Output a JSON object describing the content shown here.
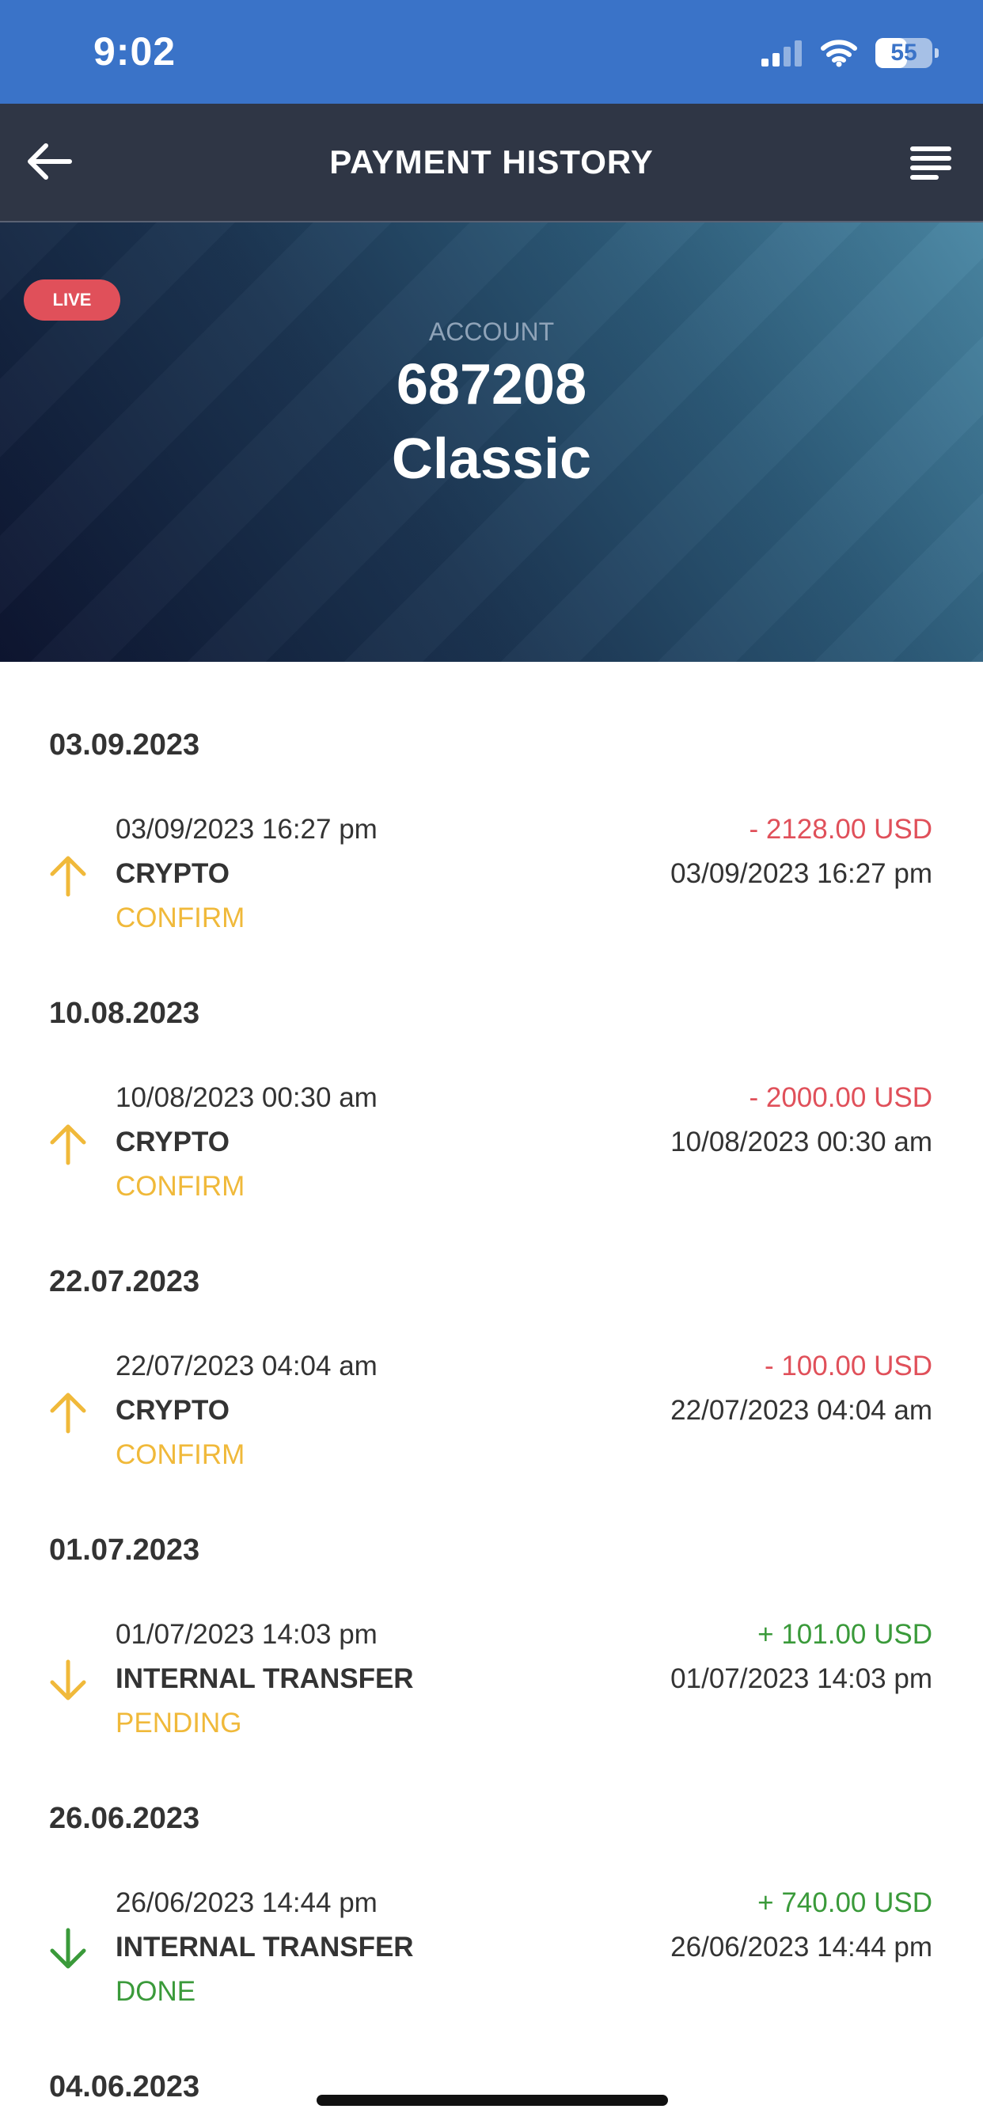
{
  "status_bar": {
    "time": "9:02",
    "battery": "55",
    "battery_level": 0.55
  },
  "nav": {
    "title": "PAYMENT HISTORY"
  },
  "account": {
    "badge": "LIVE",
    "label": "ACCOUNT",
    "number": "687208",
    "type": "Classic"
  },
  "colors": {
    "negative": "#e0505a",
    "positive": "#3a9a3a",
    "pending": "#f0b93a",
    "done": "#3a9a3a",
    "up_arrow": "#f0b93a"
  },
  "groups": [
    {
      "date": "03.09.2023",
      "tx": {
        "time": "03/09/2023 16:27 pm",
        "amount": "- 2128.00 USD",
        "method": "CRYPTO",
        "time_right": "03/09/2023 16:27 pm",
        "status": "CONFIRM",
        "direction": "up"
      }
    },
    {
      "date": "10.08.2023",
      "tx": {
        "time": "10/08/2023 00:30 am",
        "amount": "- 2000.00 USD",
        "method": "CRYPTO",
        "time_right": "10/08/2023 00:30 am",
        "status": "CONFIRM",
        "direction": "up"
      }
    },
    {
      "date": "22.07.2023",
      "tx": {
        "time": "22/07/2023 04:04 am",
        "amount": "- 100.00 USD",
        "method": "CRYPTO",
        "time_right": "22/07/2023 04:04 am",
        "status": "CONFIRM",
        "direction": "up"
      }
    },
    {
      "date": "01.07.2023",
      "tx": {
        "time": "01/07/2023 14:03 pm",
        "amount": "+ 101.00 USD",
        "method": "INTERNAL TRANSFER",
        "time_right": "01/07/2023 14:03 pm",
        "status": "PENDING",
        "direction": "down"
      }
    },
    {
      "date": "26.06.2023",
      "tx": {
        "time": "26/06/2023 14:44 pm",
        "amount": "+ 740.00 USD",
        "method": "INTERNAL TRANSFER",
        "time_right": "26/06/2023 14:44 pm",
        "status": "DONE",
        "direction": "down"
      }
    },
    {
      "date": "04.06.2023"
    }
  ]
}
